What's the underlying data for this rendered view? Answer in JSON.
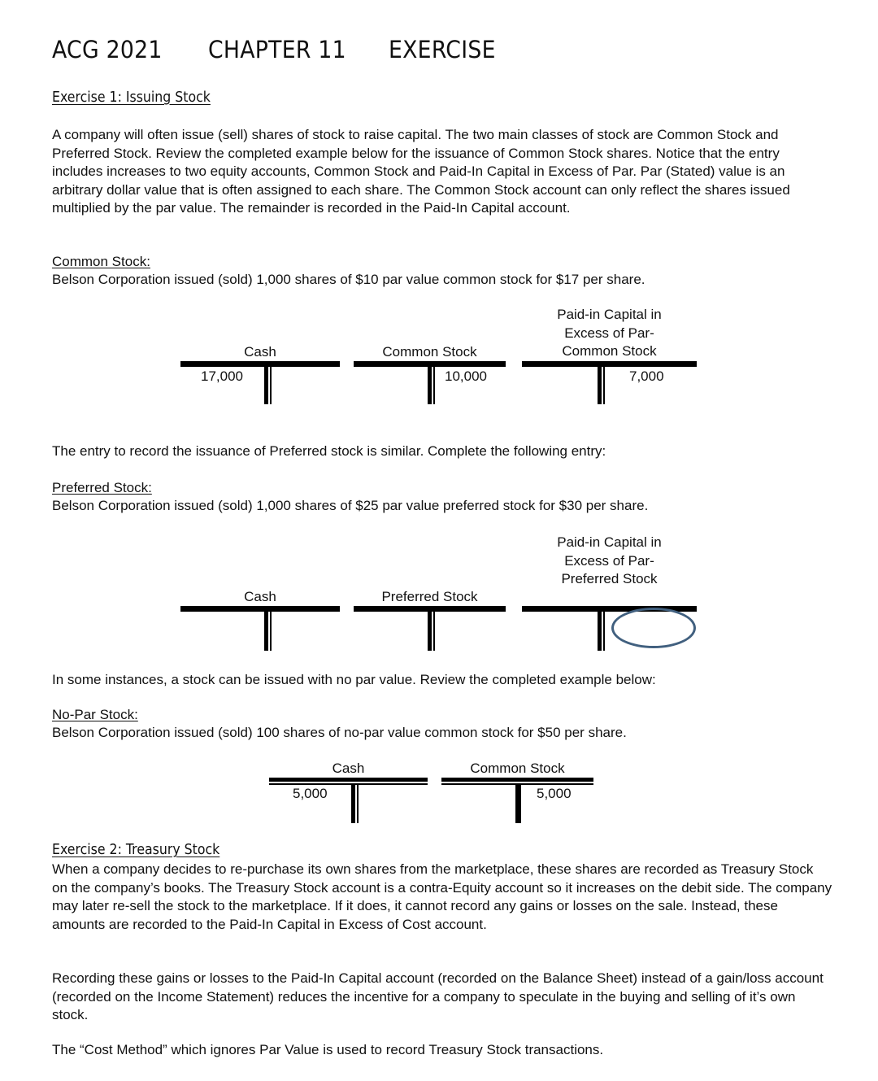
{
  "header": {
    "course": "ACG 2021",
    "chapter": "CHAPTER 11",
    "type": "EXERCISE"
  },
  "exercise1": {
    "heading": "Exercise 1:  Issuing Stock",
    "intro": "A company will often issue (sell) shares of stock to raise capital.  The two main classes of stock are Common Stock and Preferred Stock.  Review the completed example below for the issuance of Common Stock shares.  Notice that the entry includes increases to two equity accounts, Common Stock and Paid-In Capital in Excess of Par.  Par (Stated) value is an arbitrary dollar value that is often assigned to each share.  The Common Stock account can only reflect the shares issued multiplied by the par value.  The remainder is recorded in the Paid-In Capital account.",
    "common": {
      "subheading": "Common Stock:",
      "description": "Belson Corporation issued (sold) 1,000 shares of $10 par value common stock for $17 per share.",
      "t_accounts": [
        {
          "title": "Cash",
          "debit": "17,000",
          "credit": ""
        },
        {
          "title": "Common Stock",
          "debit": "",
          "credit": "10,000"
        },
        {
          "title_lines": [
            "Paid-in Capital in",
            "Excess of Par-",
            "Common Stock"
          ],
          "debit": "",
          "credit": "7,000"
        }
      ]
    },
    "transition": "The entry to record the issuance of Preferred stock is similar. Complete the following entry:",
    "preferred": {
      "subheading": "Preferred Stock:",
      "description": "Belson Corporation issued (sold) 1,000 shares of $25 par value preferred stock for $30 per share.",
      "t_accounts": [
        {
          "title": "Cash",
          "debit": "",
          "credit": ""
        },
        {
          "title": "Preferred Stock",
          "debit": "",
          "credit": ""
        },
        {
          "title_lines": [
            "Paid-in Capital in",
            "Excess of Par-",
            "Preferred Stock"
          ],
          "debit": "",
          "credit": ""
        }
      ],
      "highlight_color": "#41607f"
    },
    "nopar_intro": "In some instances, a stock can be issued with no par value.  Review the completed example below:",
    "nopar": {
      "subheading": "No-Par Stock:",
      "description": "Belson Corporation issued (sold) 100 shares of no-par value common stock for $50 per share.",
      "t_accounts": [
        {
          "title": "Cash",
          "debit": "5,000",
          "credit": ""
        },
        {
          "title": "Common Stock",
          "debit": "",
          "credit": "5,000"
        }
      ]
    }
  },
  "exercise2": {
    "heading": "Exercise 2:  Treasury Stock",
    "para1": "When a company decides to re-purchase its own shares from the marketplace, these shares are recorded as Treasury Stock on the company’s books.  The Treasury Stock account is a contra-Equity account so it increases on the debit side.  The company may later re-sell the stock to the marketplace.  If it does, it cannot record any gains or losses on the sale.  Instead, these amounts are recorded to the Paid-In Capital in Excess of Cost account.",
    "para2": "Recording these gains or losses to the Paid-In Capital account (recorded on the Balance Sheet) instead of a gain/loss account (recorded on the Income Statement) reduces the incentive for a company to speculate in the buying and selling of it’s own stock.",
    "para3": "The “Cost Method” which ignores Par Value is used to record Treasury Stock transactions."
  }
}
